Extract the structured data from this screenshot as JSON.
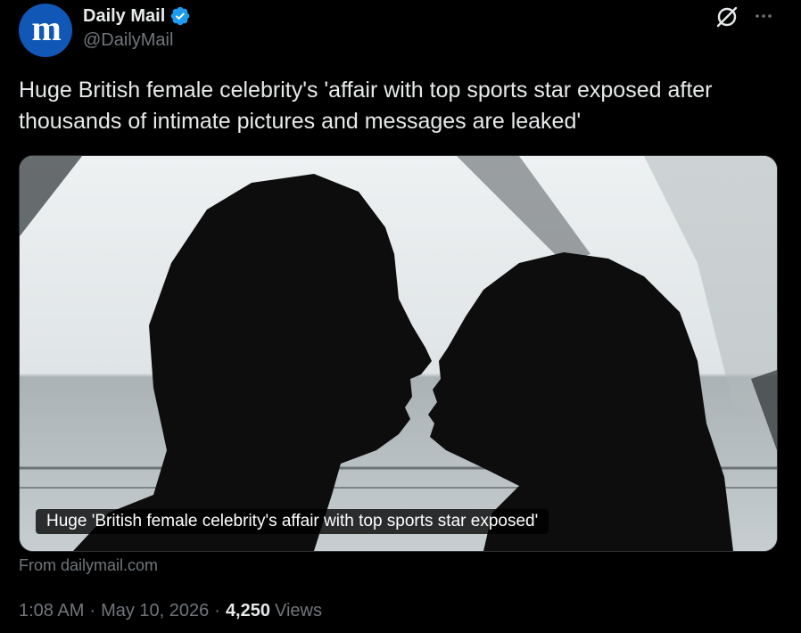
{
  "author": {
    "display_name": "Daily Mail",
    "handle": "@DailyMail",
    "avatar_glyph": "m",
    "avatar_color": "#1157b6",
    "verified": true,
    "verified_color": "#1d9bf0"
  },
  "header_actions": {
    "grok_icon": "grok-slash-icon",
    "more_icon": "more-horizontal-icon"
  },
  "tweet": {
    "text": "Huge British female celebrity's 'affair with top sports star exposed after thousands of intimate pictures and messages are leaked'"
  },
  "media": {
    "caption": "Huge 'British female celebrity's affair with top sports star exposed'",
    "source": "From dailymail.com"
  },
  "meta": {
    "time": "1:08 AM",
    "date": "May 10, 2026",
    "views_count": "4,250",
    "views_label": "Views"
  },
  "colors": {
    "background": "#000000",
    "primary_text": "#e7e9ea",
    "secondary_text": "#71767b"
  }
}
